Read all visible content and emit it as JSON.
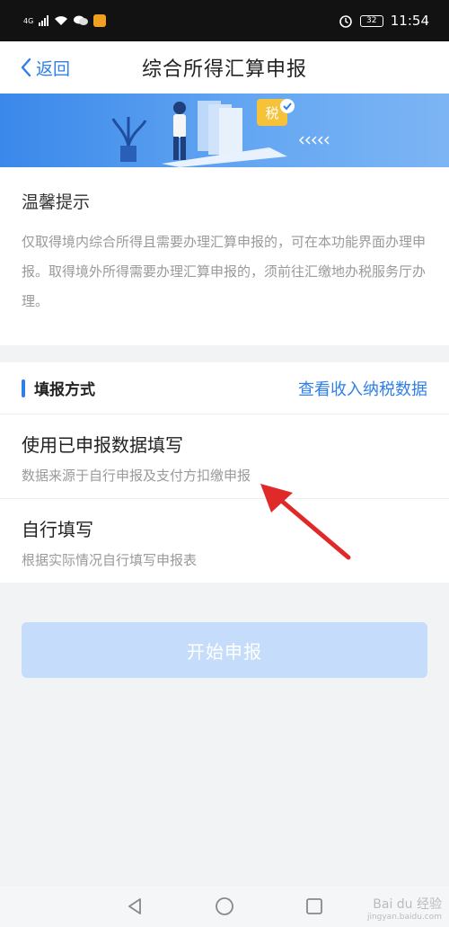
{
  "status_bar": {
    "network": "4G",
    "battery": "32",
    "time": "11:54"
  },
  "nav": {
    "back_label": "返回",
    "title": "综合所得汇算申报"
  },
  "banner": {
    "tax_badge": "税"
  },
  "notice": {
    "title": "温馨提示",
    "body": "仅取得境内综合所得且需要办理汇算申报的，可在本功能界面办理申报。取得境外所得需要办理汇算申报的，须前往汇缴地办税服务厅办理。"
  },
  "method": {
    "title": "填报方式",
    "link": "查看收入纳税数据",
    "options": [
      {
        "title": "使用已申报数据填写",
        "subtitle": "数据来源于自行申报及支付方扣缴申报"
      },
      {
        "title": "自行填写",
        "subtitle": "根据实际情况自行填写申报表"
      }
    ]
  },
  "start_button": {
    "label": "开始申报"
  },
  "watermark": {
    "brand": "Bai du 经验",
    "url": "jingyan.baidu.com"
  },
  "colors": {
    "accent": "#2f7fe8",
    "button_disabled": "#c5ddfa",
    "arrow": "#e02a2a"
  }
}
